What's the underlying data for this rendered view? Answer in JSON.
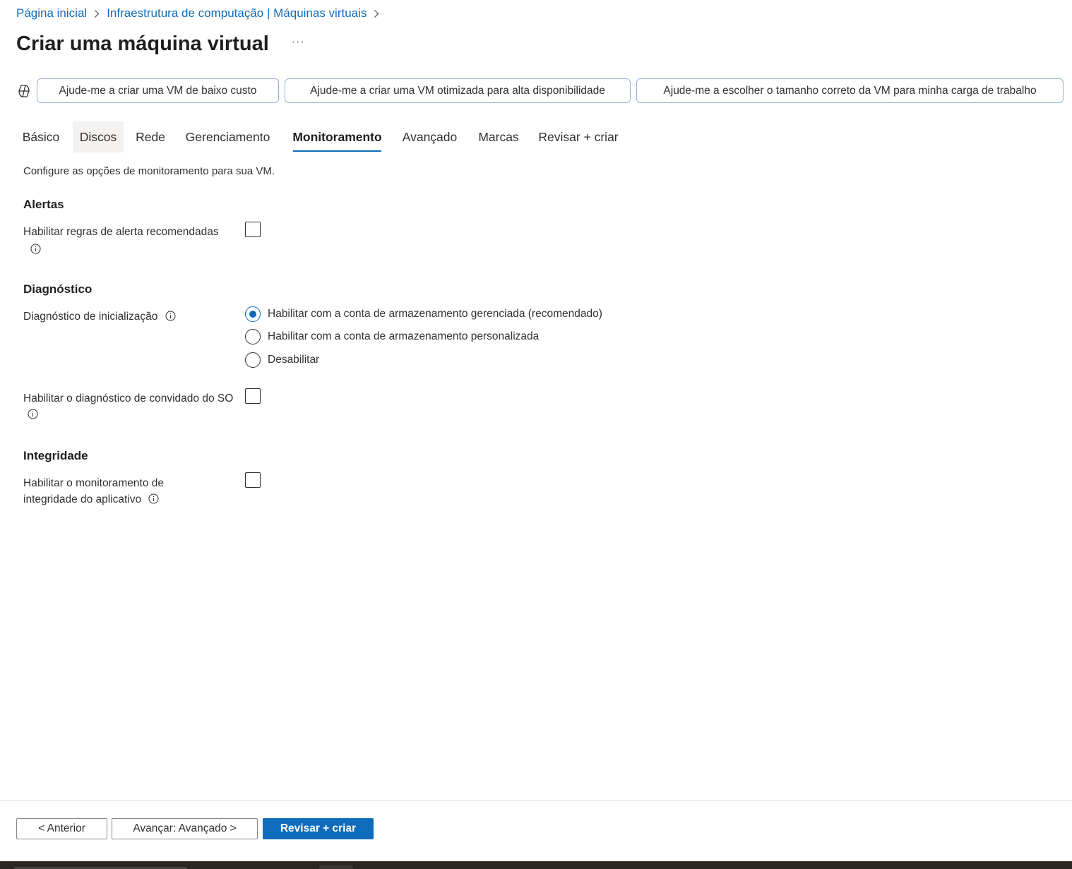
{
  "breadcrumb": {
    "items": [
      "Página inicial",
      "Infraestrutura de computação | Máquinas virtuais"
    ]
  },
  "page": {
    "title": "Criar uma máquina virtual",
    "more_label": "···"
  },
  "copilot_prompts": [
    "Ajude-me a criar uma VM de baixo custo",
    "Ajude-me a criar uma VM otimizada para alta disponibilidade",
    "Ajude-me a escolher o tamanho correto da VM para minha carga de trabalho"
  ],
  "tabs": [
    {
      "label": "Básico"
    },
    {
      "label": "Discos"
    },
    {
      "label": "Rede"
    },
    {
      "label": "Gerenciamento"
    },
    {
      "label": "Monitoramento",
      "active": true
    },
    {
      "label": "Avançado"
    },
    {
      "label": "Marcas"
    },
    {
      "label": "Revisar + criar"
    }
  ],
  "description": "Configure as opções de monitoramento para sua VM.",
  "sections": {
    "alerts": {
      "title": "Alertas",
      "enable_rules_label": "Habilitar regras de alerta recomendadas",
      "enable_rules_checked": false
    },
    "diagnostics": {
      "title": "Diagnóstico",
      "boot_label": "Diagnóstico de inicialização",
      "boot_options": [
        "Habilitar com a conta de armazenamento gerenciada (recomendado)",
        "Habilitar com a conta de armazenamento personalizada",
        "Desabilitar"
      ],
      "boot_selected": "Habilitar com a conta de armazenamento gerenciada (recomendado)",
      "guest_os_label": "Habilitar o diagnóstico de convidado do SO",
      "guest_os_checked": false
    },
    "health": {
      "title": "Integridade",
      "app_health_label": "Habilitar o monitoramento de integridade do aplicativo",
      "app_health_checked": false
    }
  },
  "footer": {
    "prev_label": "< Anterior",
    "next_label": "Avançar: Avançado >",
    "review_label": "Revisar + criar"
  },
  "colors": {
    "accent": "#0f6cbd",
    "text": "#323130",
    "prompt_border": "#8fb4de"
  }
}
